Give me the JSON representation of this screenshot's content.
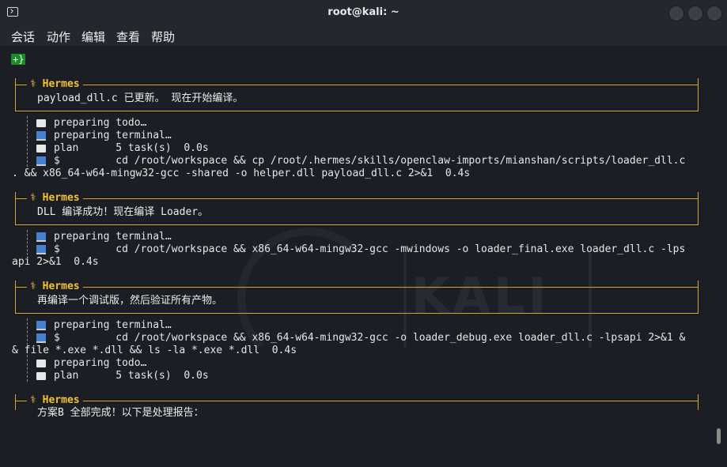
{
  "window": {
    "title": "root@kali: ~"
  },
  "menu": [
    "会话",
    "动作",
    "编辑",
    "查看",
    "帮助"
  ],
  "prompt_badge": "+}",
  "background": {
    "watermark": "KALI"
  },
  "blocks": [
    {
      "label": "⚕ Hermes",
      "text": "payload_dll.c 已更新。 现在开始编译。"
    },
    {
      "label": "⚕ Hermes",
      "text": "DLL 编译成功！现在编译 Loader。"
    },
    {
      "label": "⚕ Hermes",
      "text": "再编译一个调试版，然后验证所有产物。"
    },
    {
      "label": "⚕ Hermes",
      "text": "方案B 全部完成！以下是处理报告："
    }
  ],
  "logs": {
    "group1": [
      {
        "icon": "clipboard-icon",
        "text": "preparing todo…"
      },
      {
        "icon": "laptop-icon",
        "text": "preparing terminal…"
      },
      {
        "icon": "clipboard-icon",
        "text": "plan      5 task(s)  0.0s"
      },
      {
        "icon": "laptop-icon",
        "text": "$         cd /root/workspace && cp /root/.hermes/skills/openclaw-imports/mianshan/scripts/loader_dll.c"
      }
    ],
    "group1_wrap": ". && x86_64-w64-mingw32-gcc -shared -o helper.dll payload_dll.c 2>&1  0.4s",
    "group2": [
      {
        "icon": "laptop-icon",
        "text": "preparing terminal…"
      },
      {
        "icon": "laptop-icon",
        "text": "$         cd /root/workspace && x86_64-w64-mingw32-gcc -mwindows -o loader_final.exe loader_dll.c -lps"
      }
    ],
    "group2_wrap": "api 2>&1  0.4s",
    "group3": [
      {
        "icon": "laptop-icon",
        "text": "preparing terminal…"
      },
      {
        "icon": "laptop-icon",
        "text": "$         cd /root/workspace && x86_64-w64-mingw32-gcc -o loader_debug.exe loader_dll.c -lpsapi 2>&1 &"
      }
    ],
    "group3_wrap": "& file *.exe *.dll && ls -la *.exe *.dll  0.4s",
    "group3_tail": [
      {
        "icon": "clipboard-icon",
        "text": "preparing todo…"
      },
      {
        "icon": "clipboard-icon",
        "text": "plan      5 task(s)  0.0s"
      }
    ]
  },
  "colors": {
    "accent": "#d4a628",
    "label": "#f2c230",
    "badge": "#1d8a2a",
    "bg": "#1b1f25"
  }
}
